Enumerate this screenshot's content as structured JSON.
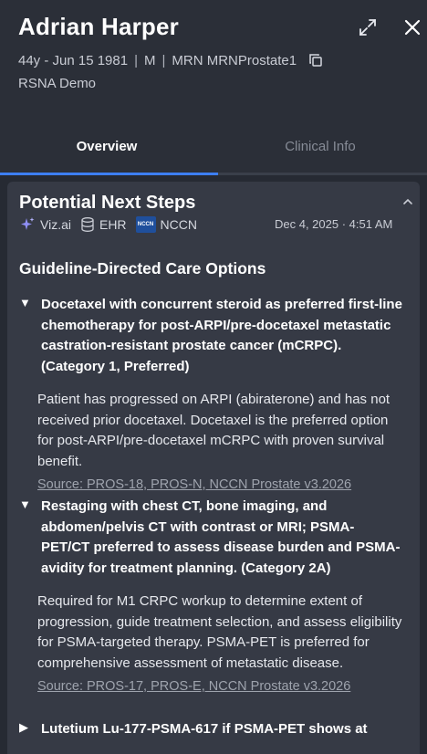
{
  "header": {
    "patient_name": "Adrian Harper",
    "age_dob": "44y - Jun 15 1981",
    "sex": "M",
    "mrn": "MRN MRNProstate1",
    "separator": "|",
    "organization": "RSNA Demo",
    "expand_icon": "expand-arrows-icon",
    "close_icon": "close-x-icon",
    "copy_icon": "copy-icon"
  },
  "tabs": [
    {
      "label": "Overview",
      "active": true
    },
    {
      "label": "Clinical Info",
      "active": false
    }
  ],
  "colors": {
    "accent": "#3d7ff2",
    "background": "#262a33",
    "card": "#363a45"
  },
  "card": {
    "title": "Potential Next Steps",
    "sources": [
      {
        "label": "Viz.ai",
        "icon": "sparkle-icon"
      },
      {
        "label": "EHR",
        "icon": "database-icon"
      },
      {
        "label": "NCCN",
        "icon": "nccn-logo-icon",
        "badge_text": "NCCN"
      }
    ],
    "timestamp": "Dec 4, 2025 · 4:51 AM",
    "section_title": "Guideline-Directed Care Options",
    "options": [
      {
        "expanded": true,
        "caret": "▼",
        "title": "Docetaxel with concurrent steroid as preferred first-line chemotherapy for post-ARPI/pre-docetaxel metastatic castration-resistant prostate cancer (mCRPC). (Category 1, Preferred)",
        "body": "Patient has progressed on ARPI (abiraterone) and has not received prior docetaxel. Docetaxel is the preferred option for post-ARPI/pre-docetaxel mCRPC with proven survival benefit.",
        "source": "Source: PROS-18, PROS-N, NCCN Prostate v3.2026"
      },
      {
        "expanded": true,
        "caret": "▼",
        "title": "Restaging with chest CT, bone imaging, and abdomen/pelvis CT with contrast or MRI; PSMA-PET/CT preferred to assess disease burden and PSMA-avidity for treatment planning. (Category 2A)",
        "body": "Required for M1 CRPC workup to determine extent of progression, guide treatment selection, and assess eligibility for PSMA-targeted therapy. PSMA-PET is preferred for comprehensive assessment of metastatic disease.",
        "source": "Source: PROS-17, PROS-E, NCCN Prostate v3.2026"
      },
      {
        "expanded": false,
        "caret": "▶",
        "title": "Lutetium Lu-177-PSMA-617 if PSMA-PET shows at"
      }
    ]
  }
}
